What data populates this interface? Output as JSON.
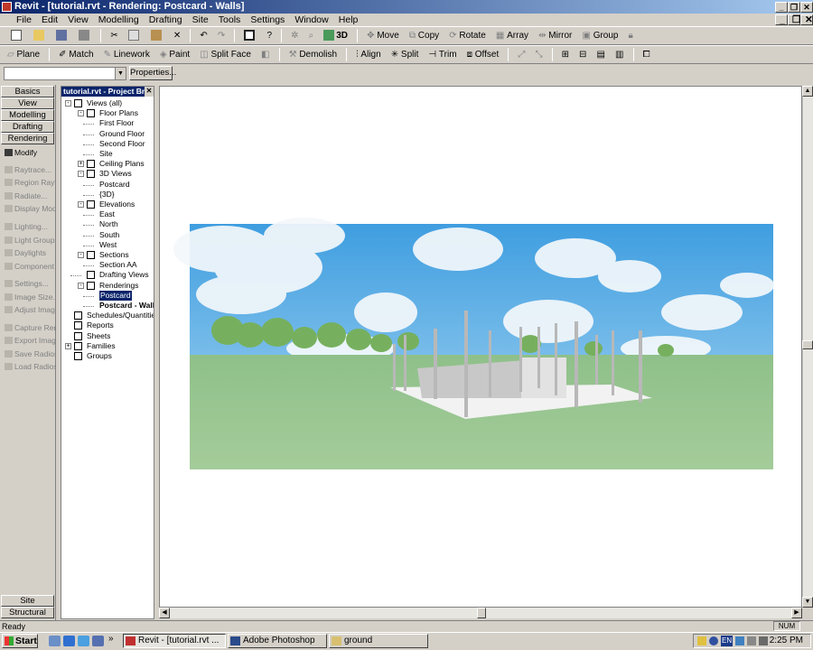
{
  "window": {
    "title": "Revit - [tutorial.rvt - Rendering: Postcard - Walls]",
    "controls": [
      "_",
      "❐",
      "✕"
    ]
  },
  "menu": [
    "File",
    "Edit",
    "View",
    "Modelling",
    "Drafting",
    "Site",
    "Tools",
    "Settings",
    "Window",
    "Help"
  ],
  "toolbar1": {
    "view3d": "3D",
    "move": "Move",
    "copy": "Copy",
    "rotate": "Rotate",
    "array": "Array",
    "mirror": "Mirror",
    "group": "Group"
  },
  "toolbar2": {
    "plane": "Plane",
    "match": "Match",
    "linework": "Linework",
    "paint": "Paint",
    "split_face": "Split Face",
    "demolish": "Demolish",
    "align": "Align",
    "split": "Split",
    "trim": "Trim",
    "offset": "Offset"
  },
  "options": {
    "type_selector": "",
    "properties": "Properties..."
  },
  "design_bar": {
    "tabs": [
      "Basics",
      "View",
      "Modelling",
      "Drafting",
      "Rendering"
    ],
    "modify": "Modify",
    "items": [
      "Raytrace...",
      "Region Raytrace",
      "Radiate...",
      "Display Mode",
      "Lighting...",
      "Light Groups",
      "Daylights",
      "Component",
      "Settings...",
      "Image Size...",
      "Adjust Image",
      "Capture Rendering",
      "Export Image",
      "Save Radiosity",
      "Load Radiosity"
    ],
    "bottom_tabs": [
      "Site",
      "Structural"
    ]
  },
  "project_browser": {
    "title": "tutorial.rvt - Project Browser",
    "close": "✕",
    "nodes": [
      {
        "label": "Views (all)",
        "level": 0,
        "exp": "-"
      },
      {
        "label": "Floor Plans",
        "level": 1,
        "exp": "-"
      },
      {
        "label": "First Floor",
        "level": 2
      },
      {
        "label": "Ground Floor",
        "level": 2
      },
      {
        "label": "Second Floor",
        "level": 2
      },
      {
        "label": "Site",
        "level": 2
      },
      {
        "label": "Ceiling Plans",
        "level": 1,
        "exp": "+"
      },
      {
        "label": "3D Views",
        "level": 1,
        "exp": "-"
      },
      {
        "label": "Postcard",
        "level": 2
      },
      {
        "label": "{3D}",
        "level": 2
      },
      {
        "label": "Elevations",
        "level": 1,
        "exp": "-"
      },
      {
        "label": "East",
        "level": 2
      },
      {
        "label": "North",
        "level": 2
      },
      {
        "label": "South",
        "level": 2
      },
      {
        "label": "West",
        "level": 2
      },
      {
        "label": "Sections",
        "level": 1,
        "exp": "-"
      },
      {
        "label": "Section AA",
        "level": 2
      },
      {
        "label": "Drafting Views",
        "level": 1
      },
      {
        "label": "Renderings",
        "level": 1,
        "exp": "-"
      },
      {
        "label": "Postcard",
        "level": 2,
        "selected": true
      },
      {
        "label": "Postcard - Walls",
        "level": 2,
        "bold": true
      },
      {
        "label": "Schedules/Quantities",
        "level": 0
      },
      {
        "label": "Reports",
        "level": 0
      },
      {
        "label": "Sheets",
        "level": 0
      },
      {
        "label": "Families",
        "level": 0,
        "exp": "+"
      },
      {
        "label": "Groups",
        "level": 0
      }
    ]
  },
  "status": {
    "text": "Ready",
    "num": "NUM"
  },
  "taskbar": {
    "start": "Start",
    "buttons": [
      "Revit - [tutorial.rvt ...",
      "Adobe Photoshop",
      "ground"
    ],
    "tray_lang": "EN",
    "clock": "2:25 PM"
  },
  "colors": {
    "title_start": "#0a246a",
    "title_end": "#a6caf0",
    "selection": "#0a246a",
    "sky": "#6fb6e6",
    "grass": "#9fc898"
  }
}
